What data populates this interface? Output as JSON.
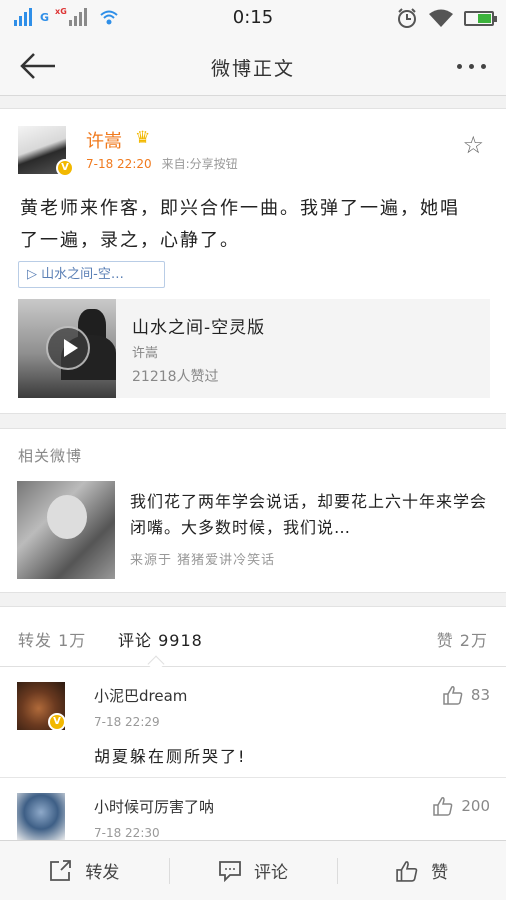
{
  "status_bar": {
    "carrier": "G",
    "network_tag": "xG",
    "time": "0:15",
    "battery_level": 0.55
  },
  "nav": {
    "title": "微博正文"
  },
  "post": {
    "author": "许嵩",
    "crown_icon": "crown-icon",
    "time": "7-18 22:20",
    "source": "来自:分享按钮",
    "text": "黄老师来作客，即兴合作一曲。我弹了一遍，她唱了一遍，录之，心静了。",
    "link_chip": "▷ 山水之间-空…",
    "media": {
      "title": "山水之间-空灵版",
      "artist": "许嵩",
      "count": "21218人赞过"
    },
    "verified_badge": "V"
  },
  "related": {
    "heading": "相关微博",
    "text": "我们花了两年学会说话，却要花上六十年来学会闭嘴。大多数时候，我们说…",
    "source": "来源于 猪猪爱讲冷笑话"
  },
  "comment_tabs": {
    "forward": "转发 1万",
    "comment": "评论 9918",
    "like": "赞 2万"
  },
  "comments": [
    {
      "name": "小泥巴dream",
      "time": "7-18 22:29",
      "text": "胡夏躲在厕所哭了!",
      "likes": "83",
      "verified_badge": "V"
    },
    {
      "name": "小时候可厉害了呐",
      "time": "7-18 22:30",
      "text": "",
      "likes": "200"
    }
  ],
  "toolbar": {
    "forward": "转发",
    "comment": "评论",
    "like": "赞"
  },
  "colors": {
    "accent_orange": "#f07a1e",
    "link_blue": "#5a7fb5",
    "status_blue": "#2f8fe8",
    "badge_gold": "#f2b800"
  }
}
